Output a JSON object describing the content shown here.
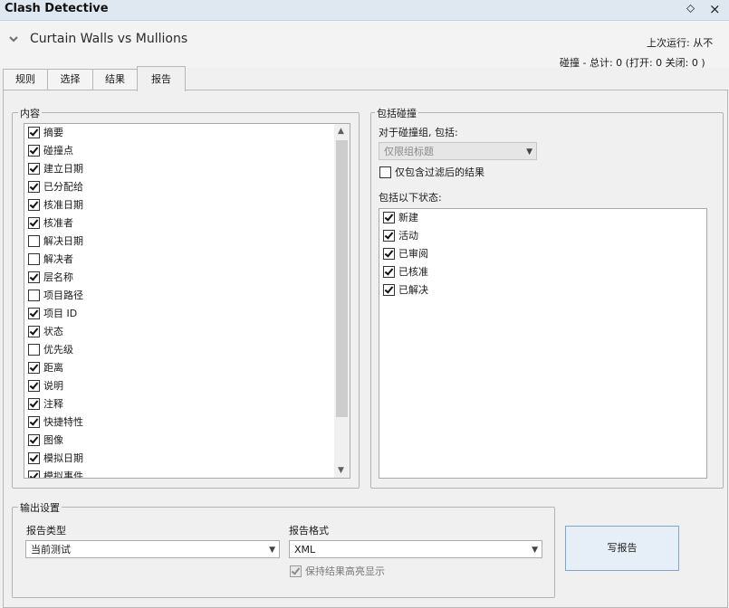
{
  "window": {
    "title": "Clash Detective",
    "pin_glyph": "⬦",
    "close_glyph": "×"
  },
  "test": {
    "name": "Curtain Walls vs Mullions",
    "last_run": "上次运行: 从不",
    "summary": "碰撞 - 总计: 0 (打开: 0 关闭: 0 )"
  },
  "tabs": [
    {
      "label": "规则"
    },
    {
      "label": "选择"
    },
    {
      "label": "结果"
    },
    {
      "label": "报告",
      "active": true
    }
  ],
  "contents": {
    "legend": "内容",
    "items": [
      {
        "label": "摘要",
        "checked": true
      },
      {
        "label": "碰撞点",
        "checked": true
      },
      {
        "label": "建立日期",
        "checked": true
      },
      {
        "label": "已分配给",
        "checked": true
      },
      {
        "label": "核准日期",
        "checked": true
      },
      {
        "label": "核准者",
        "checked": true
      },
      {
        "label": "解决日期",
        "checked": false
      },
      {
        "label": "解决者",
        "checked": false
      },
      {
        "label": "层名称",
        "checked": true
      },
      {
        "label": "项目路径",
        "checked": false
      },
      {
        "label": "项目 ID",
        "checked": true
      },
      {
        "label": "状态",
        "checked": true
      },
      {
        "label": "优先级",
        "checked": false
      },
      {
        "label": "距离",
        "checked": true
      },
      {
        "label": "说明",
        "checked": true
      },
      {
        "label": "注释",
        "checked": true
      },
      {
        "label": "快捷特性",
        "checked": true
      },
      {
        "label": "图像",
        "checked": true
      },
      {
        "label": "模拟日期",
        "checked": true
      },
      {
        "label": "模拟事件",
        "checked": true
      }
    ]
  },
  "include_clashes": {
    "legend": "包括碰撞",
    "group_label": "对于碰撞组, 包括:",
    "group_select": "仅限组标题",
    "filtered_only_label": "仅包含过滤后的结果",
    "filtered_only_checked": false,
    "status_label": "包括以下状态:",
    "statuses": [
      {
        "label": "新建",
        "checked": true
      },
      {
        "label": "活动",
        "checked": true
      },
      {
        "label": "已审阅",
        "checked": true
      },
      {
        "label": "已核准",
        "checked": true
      },
      {
        "label": "已解决",
        "checked": true
      }
    ]
  },
  "output": {
    "legend": "输出设置",
    "report_type_label": "报告类型",
    "report_type_value": "当前测试",
    "report_format_label": "报告格式",
    "report_format_value": "XML",
    "keep_highlight_label": "保持结果高亮显示",
    "keep_highlight_checked": true
  },
  "write_report_label": "写报告"
}
